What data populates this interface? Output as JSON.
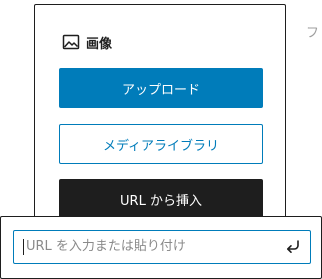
{
  "block": {
    "label": "画像",
    "icon": "image-icon"
  },
  "buttons": {
    "upload": "アップロード",
    "media_library": "メディアライブラリ",
    "insert_from_url": "URL から挿入"
  },
  "edge_text": "フ",
  "url_input": {
    "placeholder": "URL を入力または貼り付け",
    "value": "",
    "submit_icon": "enter-return-icon"
  },
  "colors": {
    "accent": "#007cba",
    "dark": "#1e1e1e",
    "border": "#1e1e1e"
  }
}
